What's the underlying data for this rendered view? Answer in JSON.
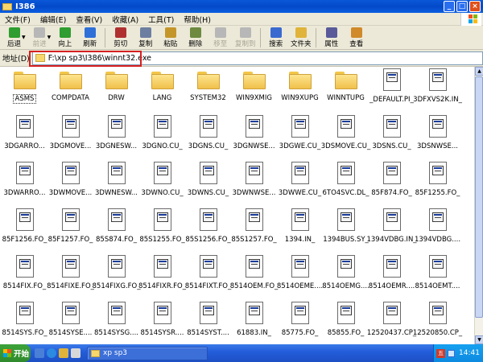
{
  "window": {
    "title": "I386"
  },
  "menu": [
    "文件(F)",
    "编辑(E)",
    "查看(V)",
    "收藏(A)",
    "工具(T)",
    "帮助(H)"
  ],
  "toolbar": [
    {
      "name": "back",
      "label": "后退",
      "color": "#2f9d2f",
      "disabled": false,
      "dropdown": true
    },
    {
      "name": "forward",
      "label": "前进",
      "color": "#b7b7b7",
      "disabled": true,
      "dropdown": true
    },
    {
      "name": "up",
      "label": "向上",
      "color": "#2f9d2f",
      "disabled": false
    },
    {
      "name": "refresh",
      "label": "刷新",
      "color": "#2f6fd8",
      "disabled": false
    },
    {
      "name": "cut",
      "label": "剪切",
      "color": "#b03030",
      "disabled": false
    },
    {
      "name": "copy",
      "label": "复制",
      "color": "#6d7fa0",
      "disabled": false
    },
    {
      "name": "paste",
      "label": "粘贴",
      "color": "#c4962a",
      "disabled": false
    },
    {
      "name": "delete",
      "label": "删除",
      "color": "#6d8a40",
      "disabled": false
    },
    {
      "name": "move-to",
      "label": "移至",
      "color": "#b7b7b7",
      "disabled": true
    },
    {
      "name": "copy-to",
      "label": "复制到",
      "color": "#b7b7b7",
      "disabled": true
    },
    {
      "name": "search",
      "label": "搜索",
      "color": "#3a6ad0",
      "disabled": false
    },
    {
      "name": "folders",
      "label": "文件夹",
      "color": "#e0b33a",
      "disabled": false
    },
    {
      "name": "properties",
      "label": "属性",
      "color": "#5a5a9a",
      "disabled": false
    },
    {
      "name": "views",
      "label": "查看",
      "color": "#d08a2a",
      "disabled": false
    }
  ],
  "address": {
    "label": "地址(D)",
    "value": "F:\\xp sp3\\I386\\winnt32.exe"
  },
  "items": [
    {
      "label": "ASMS",
      "type": "folder",
      "selected": true
    },
    {
      "label": "COMPDATA",
      "type": "folder"
    },
    {
      "label": "DRW",
      "type": "folder"
    },
    {
      "label": "LANG",
      "type": "folder"
    },
    {
      "label": "SYSTEM32",
      "type": "folder"
    },
    {
      "label": "WIN9XMIG",
      "type": "folder"
    },
    {
      "label": "WIN9XUPG",
      "type": "folder"
    },
    {
      "label": "WINNTUPG",
      "type": "folder"
    },
    {
      "label": "_DEFAULT.PI_",
      "type": "file"
    },
    {
      "label": "3DFXVS2K.IN_",
      "type": "file"
    },
    {
      "label": "3DGARRO...",
      "type": "file"
    },
    {
      "label": "3DGMOVE...",
      "type": "file"
    },
    {
      "label": "3DGNESW...",
      "type": "file"
    },
    {
      "label": "3DGNO.CU_",
      "type": "file"
    },
    {
      "label": "3DGNS.CU_",
      "type": "file"
    },
    {
      "label": "3DGNWSE...",
      "type": "file"
    },
    {
      "label": "3DGWE.CU_",
      "type": "file"
    },
    {
      "label": "3DSMOVE.CU_",
      "type": "file"
    },
    {
      "label": "3DSNS.CU_",
      "type": "file"
    },
    {
      "label": "3DSNWSE...",
      "type": "file"
    },
    {
      "label": "3DWARRO...",
      "type": "file"
    },
    {
      "label": "3DWMOVE...",
      "type": "file"
    },
    {
      "label": "3DWNESW...",
      "type": "file"
    },
    {
      "label": "3DWNO.CU_",
      "type": "file"
    },
    {
      "label": "3DWNS.CU_",
      "type": "file"
    },
    {
      "label": "3DWNWSE...",
      "type": "file"
    },
    {
      "label": "3DWWE.CU_",
      "type": "file"
    },
    {
      "label": "6TO4SVC.DL_",
      "type": "file"
    },
    {
      "label": "85F874.FO_",
      "type": "file"
    },
    {
      "label": "85F1255.FO_",
      "type": "file"
    },
    {
      "label": "85F1256.FO_",
      "type": "file"
    },
    {
      "label": "85F1257.FO_",
      "type": "file"
    },
    {
      "label": "85S874.FO_",
      "type": "file"
    },
    {
      "label": "85S1255.FO_",
      "type": "file"
    },
    {
      "label": "85S1256.FO_",
      "type": "file"
    },
    {
      "label": "85S1257.FO_",
      "type": "file"
    },
    {
      "label": "1394.IN_",
      "type": "file"
    },
    {
      "label": "1394BUS.SY_",
      "type": "file"
    },
    {
      "label": "1394VDBG.IN_",
      "type": "file"
    },
    {
      "label": "1394VDBG....",
      "type": "file"
    },
    {
      "label": "8514FIX.FO_",
      "type": "file"
    },
    {
      "label": "8514FIXE.FO_",
      "type": "file"
    },
    {
      "label": "8514FIXG.FO_",
      "type": "file"
    },
    {
      "label": "8514FIXR.FO_",
      "type": "file"
    },
    {
      "label": "8514FIXT.FO_",
      "type": "file"
    },
    {
      "label": "8514OEM.FO_",
      "type": "file"
    },
    {
      "label": "8514OEME....",
      "type": "file"
    },
    {
      "label": "8514OEMG....",
      "type": "file"
    },
    {
      "label": "8514OEMR....",
      "type": "file"
    },
    {
      "label": "8514OEMT....",
      "type": "file"
    },
    {
      "label": "8514SYS.FO_",
      "type": "file"
    },
    {
      "label": "8514SYSE....",
      "type": "file"
    },
    {
      "label": "8514SYSG....",
      "type": "file"
    },
    {
      "label": "8514SYSR....",
      "type": "file"
    },
    {
      "label": "8514SYST....",
      "type": "file"
    },
    {
      "label": "61883.IN_",
      "type": "file"
    },
    {
      "label": "85775.FO_",
      "type": "file"
    },
    {
      "label": "85855.FO_",
      "type": "file"
    },
    {
      "label": "12520437.CP_",
      "type": "file"
    },
    {
      "label": "12520850.CP_",
      "type": "file"
    }
  ],
  "taskbar": {
    "start_label": "开始",
    "task_label": "xp sp3",
    "ime_label": "五",
    "clock": "14:41"
  }
}
